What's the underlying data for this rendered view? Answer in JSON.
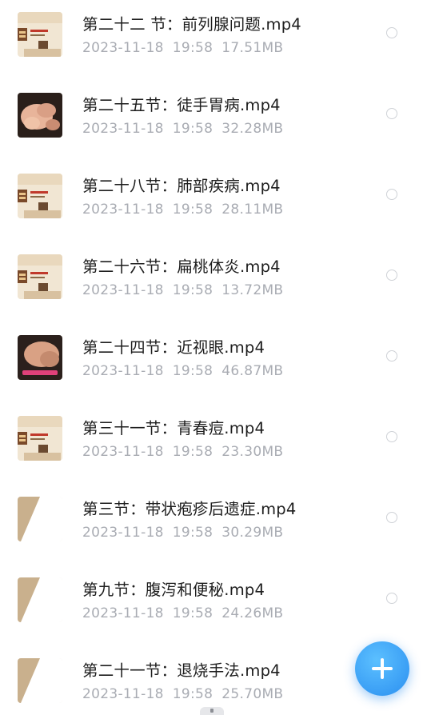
{
  "files": [
    {
      "name": "第二十二 节：前列腺问题.mp4",
      "date": "2023-11-18",
      "time": "19:58",
      "size": "17.51MB",
      "thumb": "book-cover"
    },
    {
      "name": "第二十五节：徒手胃病.mp4",
      "date": "2023-11-18",
      "time": "19:58",
      "size": "32.28MB",
      "thumb": "hands-photo"
    },
    {
      "name": "第二十八节：肺部疾病.mp4",
      "date": "2023-11-18",
      "time": "19:58",
      "size": "28.11MB",
      "thumb": "book-cover"
    },
    {
      "name": "第二十六节：扁桃体炎.mp4",
      "date": "2023-11-18",
      "time": "19:58",
      "size": "13.72MB",
      "thumb": "book-cover"
    },
    {
      "name": "第二十四节：近视眼.mp4",
      "date": "2023-11-18",
      "time": "19:58",
      "size": "46.87MB",
      "thumb": "massage-photo"
    },
    {
      "name": "第三十一节：青春痘.mp4",
      "date": "2023-11-18",
      "time": "19:58",
      "size": "23.30MB",
      "thumb": "book-cover"
    },
    {
      "name": "第三节：带状疱疹后遗症.mp4",
      "date": "2023-11-18",
      "time": "19:58",
      "size": "30.29MB",
      "thumb": "beige-shape"
    },
    {
      "name": "第九节：腹泻和便秘.mp4",
      "date": "2023-11-18",
      "time": "19:58",
      "size": "24.26MB",
      "thumb": "beige-shape"
    },
    {
      "name": "第二十一节：退烧手法.mp4",
      "date": "2023-11-18",
      "time": "19:58",
      "size": "25.70MB",
      "thumb": "beige-shape"
    }
  ],
  "fab": {
    "icon": "plus-icon",
    "color": "#2b8ff0"
  },
  "colors": {
    "title": "#1e1e1e",
    "meta": "#a9acb3",
    "radio": "#cfd2d7"
  }
}
